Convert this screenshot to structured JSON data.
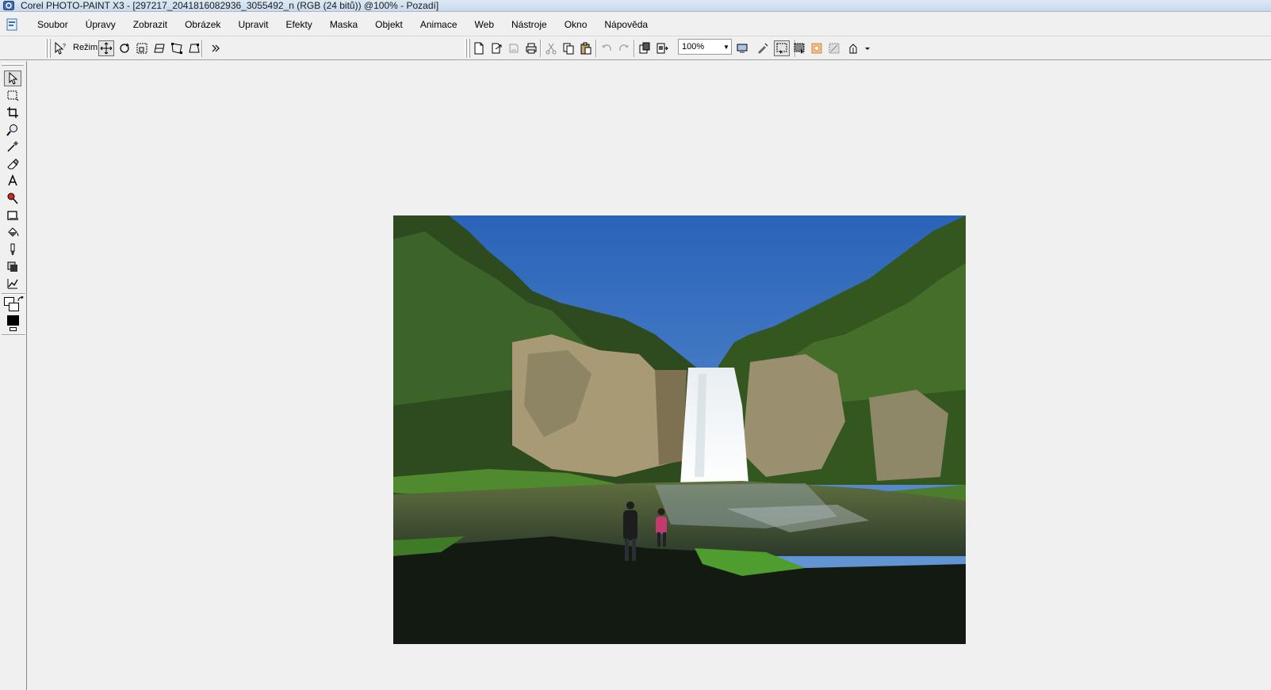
{
  "window": {
    "title": "Corel PHOTO-PAINT X3 - [297217_2041816082936_3055492_n (RGB (24 bitů)) @100% - Pozadí]"
  },
  "menu": {
    "items": [
      {
        "label": "Soubor"
      },
      {
        "label": "Úpravy"
      },
      {
        "label": "Zobrazit"
      },
      {
        "label": "Obrázek"
      },
      {
        "label": "Upravit"
      },
      {
        "label": "Efekty"
      },
      {
        "label": "Maska"
      },
      {
        "label": "Objekt"
      },
      {
        "label": "Animace"
      },
      {
        "label": "Web"
      },
      {
        "label": "Nástroje"
      },
      {
        "label": "Okno"
      },
      {
        "label": "Nápověda"
      }
    ]
  },
  "toolbar": {
    "mode_label": "Režim",
    "zoom_value": "100%",
    "property_icons": [
      "object-pick-help-icon",
      "transform-position-icon",
      "transform-rotate-icon",
      "transform-scale-icon",
      "transform-skew-icon",
      "transform-distort-icon",
      "transform-perspective-icon",
      "more-icon"
    ],
    "standard_icons": [
      "new-icon",
      "open-icon",
      "save-icon",
      "print-icon",
      "cut-icon",
      "copy-icon",
      "paste-icon",
      "undo-icon",
      "redo-icon",
      "import-icon",
      "export-icon",
      "full-screen-icon",
      "launcher-icon",
      "mask-marquee-icon",
      "object-marquee-icon",
      "mask-overlay-icon",
      "checkpoint-icon",
      "color-icon"
    ]
  },
  "toolbox": {
    "tools": [
      "pick-tool-icon",
      "rectangle-mask-icon",
      "crop-tool-icon",
      "zoom-tool-icon",
      "eyedropper-tool-icon",
      "eraser-tool-icon",
      "text-tool-icon",
      "red-eye-tool-icon",
      "rectangle-tool-icon",
      "fill-tool-icon",
      "paint-tool-icon",
      "effect-tool-icon",
      "image-sprayer-icon"
    ],
    "paper_color": "#ffffff",
    "paint_color": "#000000",
    "fill_color": "#ffffff"
  },
  "colors": {
    "titlebar": "#c9d9ec",
    "chrome": "#f0f0f0",
    "workspace": "#f0f0f0"
  },
  "document": {
    "image_subject": "waterfall-landscape"
  }
}
